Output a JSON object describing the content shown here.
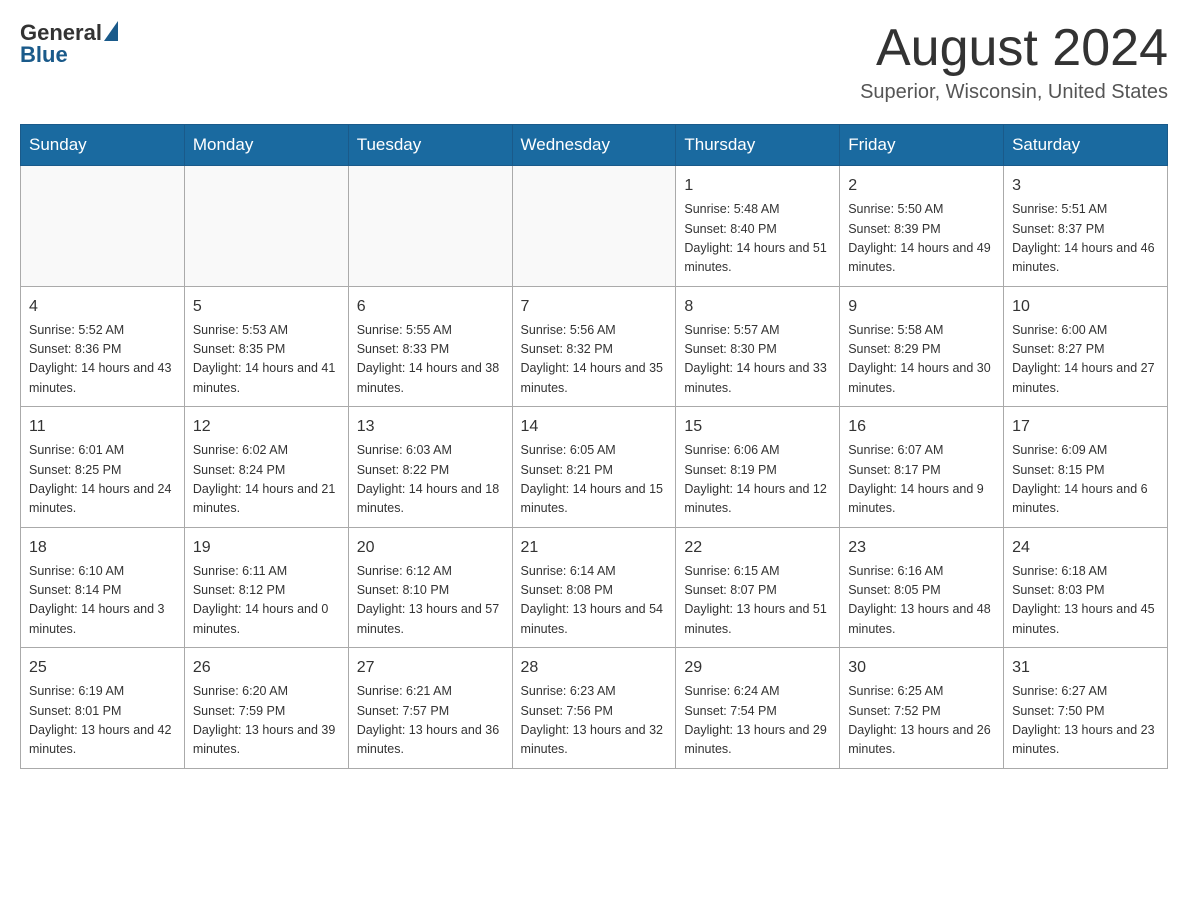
{
  "logo": {
    "general": "General",
    "blue": "Blue"
  },
  "title": "August 2024",
  "location": "Superior, Wisconsin, United States",
  "days_of_week": [
    "Sunday",
    "Monday",
    "Tuesday",
    "Wednesday",
    "Thursday",
    "Friday",
    "Saturday"
  ],
  "weeks": [
    [
      {
        "day": "",
        "info": ""
      },
      {
        "day": "",
        "info": ""
      },
      {
        "day": "",
        "info": ""
      },
      {
        "day": "",
        "info": ""
      },
      {
        "day": "1",
        "info": "Sunrise: 5:48 AM\nSunset: 8:40 PM\nDaylight: 14 hours and 51 minutes."
      },
      {
        "day": "2",
        "info": "Sunrise: 5:50 AM\nSunset: 8:39 PM\nDaylight: 14 hours and 49 minutes."
      },
      {
        "day": "3",
        "info": "Sunrise: 5:51 AM\nSunset: 8:37 PM\nDaylight: 14 hours and 46 minutes."
      }
    ],
    [
      {
        "day": "4",
        "info": "Sunrise: 5:52 AM\nSunset: 8:36 PM\nDaylight: 14 hours and 43 minutes."
      },
      {
        "day": "5",
        "info": "Sunrise: 5:53 AM\nSunset: 8:35 PM\nDaylight: 14 hours and 41 minutes."
      },
      {
        "day": "6",
        "info": "Sunrise: 5:55 AM\nSunset: 8:33 PM\nDaylight: 14 hours and 38 minutes."
      },
      {
        "day": "7",
        "info": "Sunrise: 5:56 AM\nSunset: 8:32 PM\nDaylight: 14 hours and 35 minutes."
      },
      {
        "day": "8",
        "info": "Sunrise: 5:57 AM\nSunset: 8:30 PM\nDaylight: 14 hours and 33 minutes."
      },
      {
        "day": "9",
        "info": "Sunrise: 5:58 AM\nSunset: 8:29 PM\nDaylight: 14 hours and 30 minutes."
      },
      {
        "day": "10",
        "info": "Sunrise: 6:00 AM\nSunset: 8:27 PM\nDaylight: 14 hours and 27 minutes."
      }
    ],
    [
      {
        "day": "11",
        "info": "Sunrise: 6:01 AM\nSunset: 8:25 PM\nDaylight: 14 hours and 24 minutes."
      },
      {
        "day": "12",
        "info": "Sunrise: 6:02 AM\nSunset: 8:24 PM\nDaylight: 14 hours and 21 minutes."
      },
      {
        "day": "13",
        "info": "Sunrise: 6:03 AM\nSunset: 8:22 PM\nDaylight: 14 hours and 18 minutes."
      },
      {
        "day": "14",
        "info": "Sunrise: 6:05 AM\nSunset: 8:21 PM\nDaylight: 14 hours and 15 minutes."
      },
      {
        "day": "15",
        "info": "Sunrise: 6:06 AM\nSunset: 8:19 PM\nDaylight: 14 hours and 12 minutes."
      },
      {
        "day": "16",
        "info": "Sunrise: 6:07 AM\nSunset: 8:17 PM\nDaylight: 14 hours and 9 minutes."
      },
      {
        "day": "17",
        "info": "Sunrise: 6:09 AM\nSunset: 8:15 PM\nDaylight: 14 hours and 6 minutes."
      }
    ],
    [
      {
        "day": "18",
        "info": "Sunrise: 6:10 AM\nSunset: 8:14 PM\nDaylight: 14 hours and 3 minutes."
      },
      {
        "day": "19",
        "info": "Sunrise: 6:11 AM\nSunset: 8:12 PM\nDaylight: 14 hours and 0 minutes."
      },
      {
        "day": "20",
        "info": "Sunrise: 6:12 AM\nSunset: 8:10 PM\nDaylight: 13 hours and 57 minutes."
      },
      {
        "day": "21",
        "info": "Sunrise: 6:14 AM\nSunset: 8:08 PM\nDaylight: 13 hours and 54 minutes."
      },
      {
        "day": "22",
        "info": "Sunrise: 6:15 AM\nSunset: 8:07 PM\nDaylight: 13 hours and 51 minutes."
      },
      {
        "day": "23",
        "info": "Sunrise: 6:16 AM\nSunset: 8:05 PM\nDaylight: 13 hours and 48 minutes."
      },
      {
        "day": "24",
        "info": "Sunrise: 6:18 AM\nSunset: 8:03 PM\nDaylight: 13 hours and 45 minutes."
      }
    ],
    [
      {
        "day": "25",
        "info": "Sunrise: 6:19 AM\nSunset: 8:01 PM\nDaylight: 13 hours and 42 minutes."
      },
      {
        "day": "26",
        "info": "Sunrise: 6:20 AM\nSunset: 7:59 PM\nDaylight: 13 hours and 39 minutes."
      },
      {
        "day": "27",
        "info": "Sunrise: 6:21 AM\nSunset: 7:57 PM\nDaylight: 13 hours and 36 minutes."
      },
      {
        "day": "28",
        "info": "Sunrise: 6:23 AM\nSunset: 7:56 PM\nDaylight: 13 hours and 32 minutes."
      },
      {
        "day": "29",
        "info": "Sunrise: 6:24 AM\nSunset: 7:54 PM\nDaylight: 13 hours and 29 minutes."
      },
      {
        "day": "30",
        "info": "Sunrise: 6:25 AM\nSunset: 7:52 PM\nDaylight: 13 hours and 26 minutes."
      },
      {
        "day": "31",
        "info": "Sunrise: 6:27 AM\nSunset: 7:50 PM\nDaylight: 13 hours and 23 minutes."
      }
    ]
  ]
}
